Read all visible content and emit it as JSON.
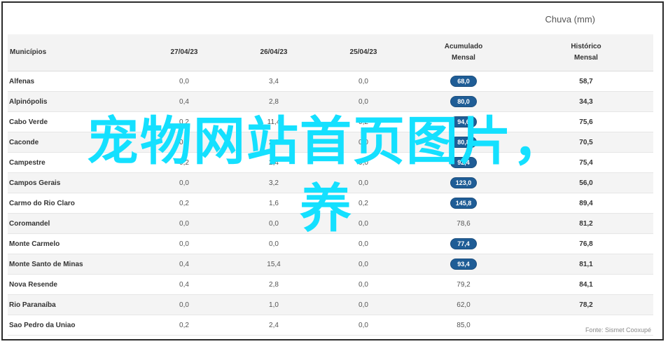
{
  "chart_title": "Chuva (mm)",
  "headers": {
    "municipio": "Municípios",
    "d1": "27/04/23",
    "d2": "26/04/23",
    "d3": "25/04/23",
    "acumulado_line1": "Acumulado",
    "acumulado_line2": "Mensal",
    "historico_line1": "Histórico",
    "historico_line2": "Mensal"
  },
  "rows": [
    {
      "name": "Alfenas",
      "d1": "0,0",
      "d2": "3,4",
      "d3": "0,0",
      "acc": "68,0",
      "hist": "58,7",
      "highlight": true
    },
    {
      "name": "Alpinópolis",
      "d1": "0,4",
      "d2": "2,8",
      "d3": "0,0",
      "acc": "80,0",
      "hist": "34,3",
      "highlight": true
    },
    {
      "name": "Cabo Verde",
      "d1": "0,2",
      "d2": "11,4",
      "d3": "0,2",
      "acc": "94,6",
      "hist": "75,6",
      "highlight": true
    },
    {
      "name": "Caconde",
      "d1": "0,2",
      "d2": "2,0",
      "d3": "0,0",
      "acc": "80,8",
      "hist": "70,5",
      "highlight": true
    },
    {
      "name": "Campestre",
      "d1": "0,2",
      "d2": "2,4",
      "d3": "0,0",
      "acc": "92,4",
      "hist": "75,4",
      "highlight": true
    },
    {
      "name": "Campos Gerais",
      "d1": "0,0",
      "d2": "3,2",
      "d3": "0,0",
      "acc": "123,0",
      "hist": "56,0",
      "highlight": true
    },
    {
      "name": "Carmo do Rio Claro",
      "d1": "0,2",
      "d2": "1,6",
      "d3": "0,2",
      "acc": "145,8",
      "hist": "89,4",
      "highlight": true
    },
    {
      "name": "Coromandel",
      "d1": "0,0",
      "d2": "0,0",
      "d3": "0,0",
      "acc": "78,6",
      "hist": "81,2",
      "highlight": false
    },
    {
      "name": "Monte Carmelo",
      "d1": "0,0",
      "d2": "0,0",
      "d3": "0,0",
      "acc": "77,4",
      "hist": "76,8",
      "highlight": true
    },
    {
      "name": "Monte Santo de Minas",
      "d1": "0,4",
      "d2": "15,4",
      "d3": "0,0",
      "acc": "93,4",
      "hist": "81,1",
      "highlight": true
    },
    {
      "name": "Nova Resende",
      "d1": "0,4",
      "d2": "2,8",
      "d3": "0,0",
      "acc": "79,2",
      "hist": "84,1",
      "highlight": false
    },
    {
      "name": "Rio Paranaíba",
      "d1": "0,0",
      "d2": "1,0",
      "d3": "0,0",
      "acc": "62,0",
      "hist": "78,2",
      "highlight": false
    },
    {
      "name": "Sao Pedro da Uniao",
      "d1": "0,2",
      "d2": "2,4",
      "d3": "0,0",
      "acc": "85,0",
      "hist": "",
      "highlight": false
    }
  ],
  "source": "Fonte: Sismet Cooxupé",
  "overlay_line1": "宠物网站首页图片，",
  "overlay_line2": "养",
  "colors": {
    "pill": "#1f5d96",
    "overlay": "#14e0ff"
  }
}
